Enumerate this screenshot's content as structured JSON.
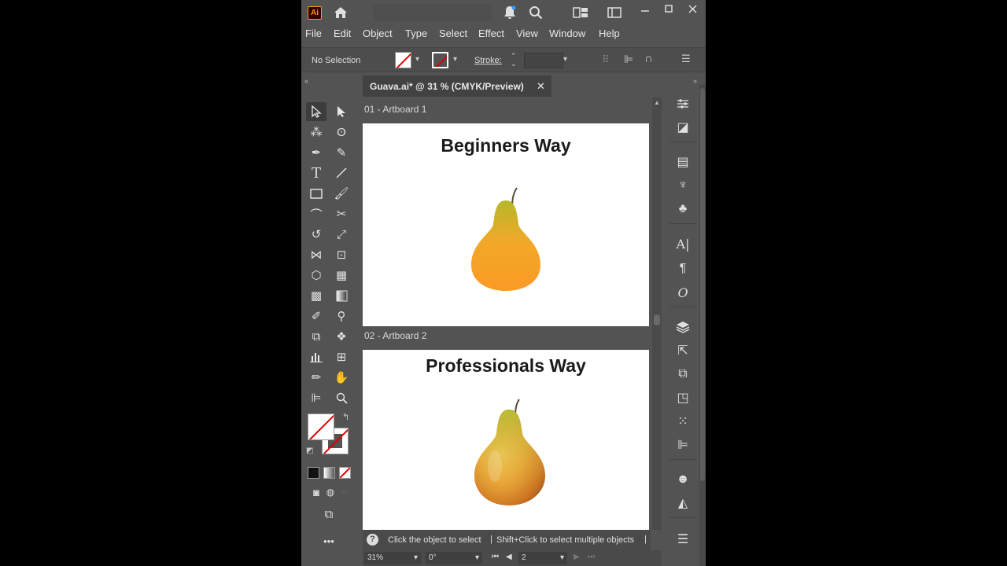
{
  "app": {
    "logo": "Ai"
  },
  "menu": [
    "File",
    "Edit",
    "Object",
    "Type",
    "Select",
    "Effect",
    "View",
    "Window",
    "Help"
  ],
  "control": {
    "selection": "No Selection",
    "stroke_label": "Stroke:"
  },
  "document": {
    "tab_title": "Guava.ai* @ 31 % (CMYK/Preview)",
    "artboards": [
      {
        "label": "01 - Artboard 1",
        "title": "Beginners Way"
      },
      {
        "label": "02 - Artboard 2",
        "title": "Professionals Way"
      }
    ]
  },
  "hint": {
    "text1": "Click the object to select",
    "sep": "|",
    "text2": "Shift+Click to select multiple objects",
    "sep2": "|"
  },
  "status": {
    "zoom": "31%",
    "rotation": "0°",
    "artboard_number": "2"
  },
  "colors": {
    "app_bg": "#535353",
    "pear_flat_top": "#b5b828",
    "pear_flat_bottom": "#fb9a26",
    "pear_realistic_top": "#b8bf36",
    "pear_realistic_bottom": "#e6892a"
  }
}
